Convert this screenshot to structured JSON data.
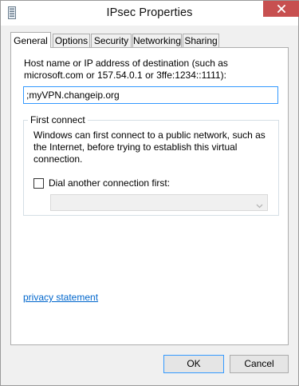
{
  "window": {
    "title": "IPsec Properties",
    "title_icon": "network-connection-icon",
    "close_icon": "close-icon"
  },
  "tabs": [
    {
      "label": "General",
      "active": true
    },
    {
      "label": "Options",
      "active": false
    },
    {
      "label": "Security",
      "active": false
    },
    {
      "label": "Networking",
      "active": false
    },
    {
      "label": "Sharing",
      "active": false
    }
  ],
  "general": {
    "host_label": "Host name or IP address of destination (such as microsoft.com or 157.54.0.1 or 3ffe:1234::1111):",
    "host_value": ";myVPN.changeip.org",
    "first_connect": {
      "legend": "First connect",
      "description": "Windows can first connect to a public network, such as the Internet, before trying to establish this virtual connection.",
      "dial_label": "Dial another connection first:",
      "dial_checked": false,
      "dial_value": ""
    },
    "privacy_link": "privacy statement"
  },
  "buttons": {
    "ok": "OK",
    "cancel": "Cancel"
  },
  "colors": {
    "close_button": "#c75050",
    "focus_border": "#3399ff",
    "link": "#0066cc"
  }
}
